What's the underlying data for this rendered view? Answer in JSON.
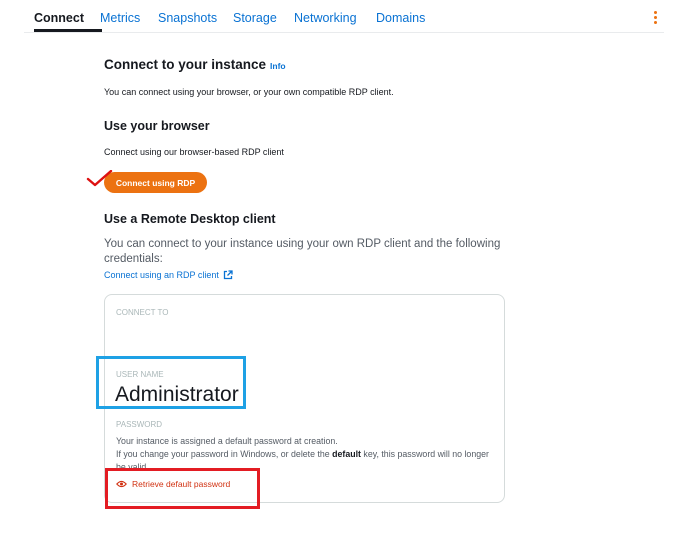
{
  "tabs": [
    {
      "label": "Connect",
      "active": true
    },
    {
      "label": "Metrics"
    },
    {
      "label": "Snapshots"
    },
    {
      "label": "Storage"
    },
    {
      "label": "Networking"
    },
    {
      "label": "Domains"
    }
  ],
  "connect": {
    "title": "Connect to your instance",
    "info_label": "Info",
    "description": "You can connect using your browser, or your own compatible RDP client."
  },
  "browser": {
    "heading": "Use your browser",
    "description": "Connect using our browser-based RDP client",
    "button_label": "Connect using RDP"
  },
  "rdp_client": {
    "heading": "Use a Remote Desktop client",
    "description": "You can connect to your instance using your own RDP client and the following credentials:",
    "link_label": "Connect using an RDP client"
  },
  "credentials": {
    "connect_to_label": "CONNECT TO",
    "username_label": "USER NAME",
    "username": "Administrator",
    "password_label": "PASSWORD",
    "password_note_1": "Your instance is assigned a default password at creation.",
    "password_note_2_before": "If you change your password in Windows, or delete the ",
    "password_note_2_bold": "default",
    "password_note_2_after": " key, this password will no longer be valid.",
    "retrieve_label": "Retrieve default password"
  },
  "icons": {
    "more": "more-vertical-icon",
    "external": "external-link-icon",
    "retrieve": "eye-icon",
    "annotation": "checkmark-icon"
  },
  "colors": {
    "accent": "#ec7211",
    "link": "#0972d3",
    "danger": "#d13212",
    "highlight_blue": "#1ea1e5",
    "highlight_red": "#e31c23"
  }
}
